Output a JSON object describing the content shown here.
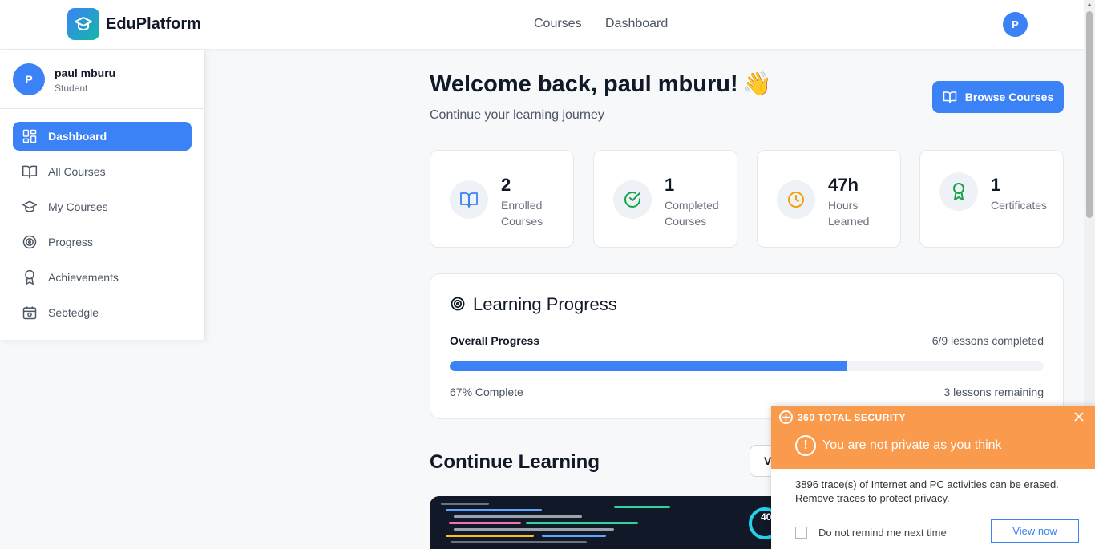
{
  "header": {
    "brand": "EduPlatform",
    "nav": [
      "Courses",
      "Dashboard"
    ],
    "avatar_initial": "P"
  },
  "sidebar": {
    "user": {
      "initial": "P",
      "name": "paul mburu",
      "role": "Student"
    },
    "items": [
      {
        "label": "Dashboard",
        "icon": "dashboard-grid-icon",
        "active": true
      },
      {
        "label": "All Courses",
        "icon": "book-open-icon",
        "active": false
      },
      {
        "label": "My Courses",
        "icon": "graduation-cap-icon",
        "active": false
      },
      {
        "label": "Progress",
        "icon": "target-icon",
        "active": false
      },
      {
        "label": "Achievements",
        "icon": "award-icon",
        "active": false
      },
      {
        "label": "Sebtedgle",
        "icon": "calendar-icon",
        "active": false
      }
    ]
  },
  "main": {
    "welcome": "Welcome back, paul mburu!",
    "welcome_emoji": "👋",
    "subtitle": "Continue your learning journey",
    "browse_button": "Browse Courses",
    "stats": [
      {
        "value": "2",
        "label": "Enrolled Courses",
        "icon": "book-open-icon",
        "color": "#3b82f6"
      },
      {
        "value": "1",
        "label": "Completed Courses",
        "icon": "check-circle-icon",
        "color": "#16a34a"
      },
      {
        "value": "47h",
        "label": "Hours Learned",
        "icon": "clock-icon",
        "color": "#f59e0b"
      },
      {
        "value": "1",
        "label": "Certificates",
        "icon": "award-icon",
        "color": "#16a34a"
      }
    ],
    "learning_progress": {
      "title": "Learning Progress",
      "overall_label": "Overall Progress",
      "lessons_completed": "6/9 lessons completed",
      "progress_percent": 67,
      "complete_text": "67% Complete",
      "remaining_text": "3 lessons remaining"
    },
    "continue_title": "Continue Learning",
    "view_button": "V",
    "course_badge": "40"
  },
  "popup": {
    "brand": "360 TOTAL SECURITY",
    "headline": "You are not private as you think",
    "body": "3896 trace(s) of Internet and PC activities can be erased. Remove traces to protect privacy.",
    "checkbox_label": "Do not remind me next time",
    "button": "View now",
    "accent": "#f99a4c"
  }
}
